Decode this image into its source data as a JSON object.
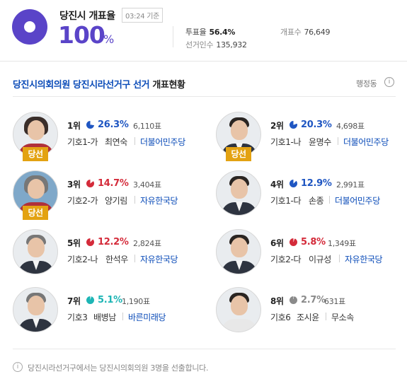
{
  "summary": {
    "title": "당진시 개표율",
    "date_badge": "03:24 기준",
    "rate_value": "100",
    "rate_unit": "%",
    "turnout_label": "투표율",
    "turnout_value": "56.4%",
    "counted_label": "개표수",
    "counted_value": "76,649",
    "electors_label": "선거인수",
    "electors_value": "135,932",
    "accent_color": "#5a44c8"
  },
  "section": {
    "title_blue": "당진시의회의원 당진시라선거구 선거",
    "title_dark": "개표현황",
    "area_link": "행정동",
    "info_icon": "i"
  },
  "candidates": [
    {
      "rank": "1위",
      "pct": "26.3%",
      "votes": "6,110표",
      "no": "기호1-가",
      "name": "최연숙",
      "party": "더불어민주당",
      "elected": "당선",
      "pie_color": "#1f56c2"
    },
    {
      "rank": "2위",
      "pct": "20.3%",
      "votes": "4,698표",
      "no": "기호1-나",
      "name": "윤명수",
      "party": "더불어민주당",
      "elected": "당선",
      "pie_color": "#1f56c2"
    },
    {
      "rank": "3위",
      "pct": "14.7%",
      "votes": "3,404표",
      "no": "기호2-가",
      "name": "양기림",
      "party": "자유한국당",
      "elected": "당선",
      "pie_color": "#d42b3a"
    },
    {
      "rank": "4위",
      "pct": "12.9%",
      "votes": "2,991표",
      "no": "기호1-다",
      "name": "손종",
      "party": "더불어민주당",
      "elected": "",
      "pie_color": "#1f56c2"
    },
    {
      "rank": "5위",
      "pct": "12.2%",
      "votes": "2,824표",
      "no": "기호2-나",
      "name": "한석우",
      "party": "자유한국당",
      "elected": "",
      "pie_color": "#d42b3a"
    },
    {
      "rank": "6위",
      "pct": "5.8%",
      "votes": "1,349표",
      "no": "기호2-다",
      "name": "이규성",
      "party": "자유한국당",
      "elected": "",
      "pie_color": "#d42b3a"
    },
    {
      "rank": "7위",
      "pct": "5.1%",
      "votes": "1,190표",
      "no": "기호3",
      "name": "배병남",
      "party": "바른미래당",
      "elected": "",
      "pie_color": "#1db5b5"
    },
    {
      "rank": "8위",
      "pct": "2.7%",
      "votes": "631표",
      "no": "기호6",
      "name": "조시윤",
      "party": "무소속",
      "elected": "",
      "pie_color": "#8a8a8a"
    }
  ],
  "footer": {
    "icon": "i",
    "text": "당진시라선거구에서는 당진시의회의원 3명을 선출합니다."
  }
}
